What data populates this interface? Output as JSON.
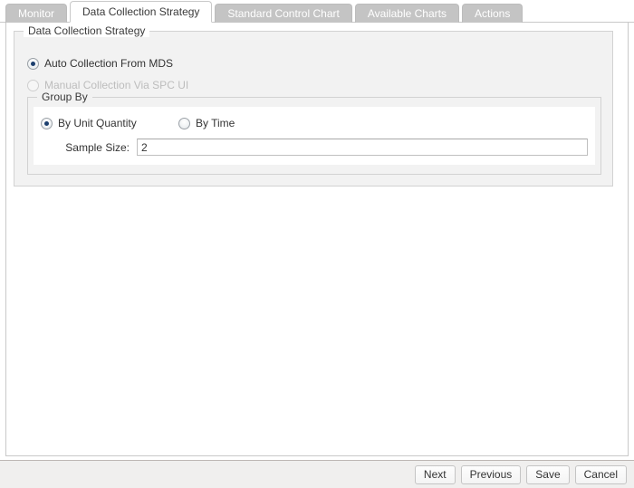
{
  "tabs": [
    {
      "label": "Monitor",
      "active": false
    },
    {
      "label": "Data Collection Strategy",
      "active": true
    },
    {
      "label": "Standard Control Chart",
      "active": false
    },
    {
      "label": "Available Charts",
      "active": false
    },
    {
      "label": "Actions",
      "active": false
    }
  ],
  "strategy_group": {
    "title": "Data Collection Strategy",
    "options": [
      {
        "label": "Auto Collection From MDS",
        "selected": true,
        "disabled": false
      },
      {
        "label": "Manual Collection Via SPC UI",
        "selected": false,
        "disabled": true
      }
    ]
  },
  "group_by": {
    "title": "Group By",
    "options": [
      {
        "label": "By Unit Quantity",
        "selected": true
      },
      {
        "label": "By Time",
        "selected": false
      }
    ],
    "sample_size": {
      "label": "Sample Size:",
      "value": "2",
      "placeholder": ""
    }
  },
  "footer": {
    "buttons": [
      {
        "label": "Next"
      },
      {
        "label": "Previous"
      },
      {
        "label": "Save"
      },
      {
        "label": "Cancel"
      }
    ]
  },
  "colors": {
    "tab_active_bg": "#ffffff",
    "tab_inactive_bg": "#c4c4c4",
    "radio_dot": "#1c3f6e",
    "panel_bg": "#f2f2f2",
    "footer_bg": "#f0efee"
  }
}
